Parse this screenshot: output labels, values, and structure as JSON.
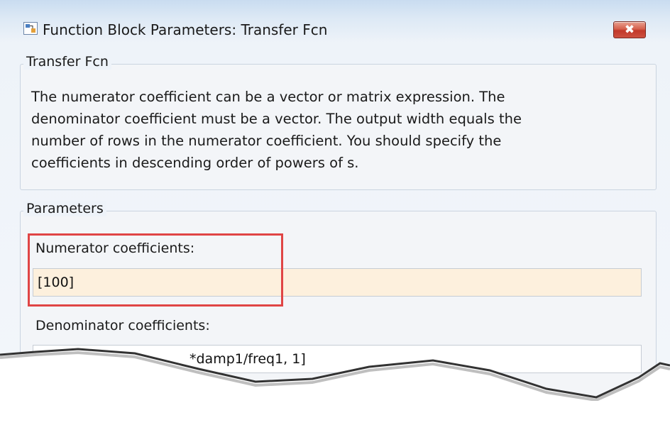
{
  "window": {
    "title": "Function Block Parameters: Transfer Fcn",
    "app_icon": "simulink-block-icon",
    "close_icon": "close-icon",
    "close_symbol": "✖"
  },
  "block_group": {
    "label": "Transfer Fcn",
    "description": "The numerator coefficient can be a vector or matrix expression. The\ndenominator coefficient must be a vector. The output width equals the\nnumber of rows in the numerator coefficient. You should specify the\ncoefficients in descending order of powers of s."
  },
  "parameters_group": {
    "label": "Parameters",
    "numerator": {
      "label": "Numerator coefficients:",
      "value": "[100]",
      "highlight_color": "#e04545"
    },
    "denominator": {
      "label": "Denominator coefficients:",
      "value_visible": "*damp1/freq1, 1]"
    }
  }
}
